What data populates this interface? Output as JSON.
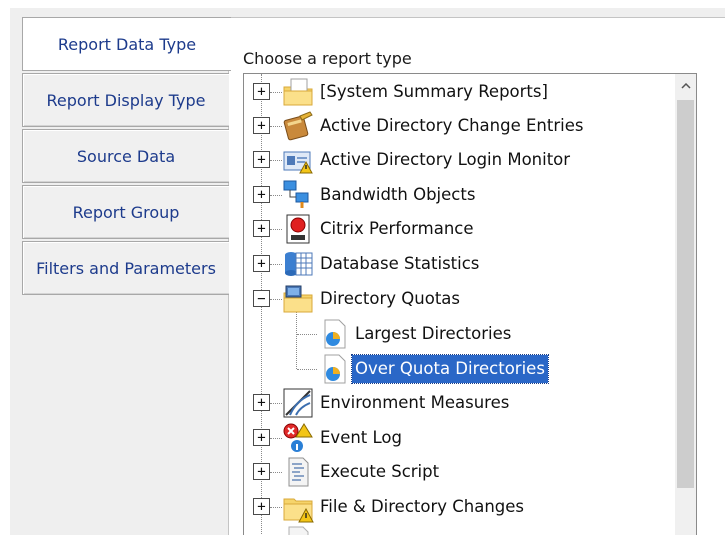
{
  "tabs": [
    {
      "label": "Report Data Type",
      "active": true
    },
    {
      "label": "Report Display Type",
      "active": false
    },
    {
      "label": "Source Data",
      "active": false
    },
    {
      "label": "Report Group",
      "active": false
    },
    {
      "label": "Filters and Parameters",
      "active": false
    }
  ],
  "panel": {
    "heading": "Choose a report type"
  },
  "tree": {
    "expander_collapsed": "+",
    "expander_expanded": "−",
    "items": [
      {
        "label": "[System Summary Reports]",
        "icon": "folder-document-icon",
        "state": "collapsed"
      },
      {
        "label": "Active Directory Change Entries",
        "icon": "book-pencil-icon",
        "state": "collapsed"
      },
      {
        "label": "Active Directory Login Monitor",
        "icon": "id-card-warning-icon",
        "state": "collapsed"
      },
      {
        "label": "Bandwidth Objects",
        "icon": "network-computers-icon",
        "state": "collapsed"
      },
      {
        "label": "Citrix Performance",
        "icon": "red-ball-icon",
        "state": "collapsed"
      },
      {
        "label": "Database Statistics",
        "icon": "database-grid-icon",
        "state": "collapsed"
      },
      {
        "label": "Directory Quotas",
        "icon": "folder-monitor-icon",
        "state": "expanded"
      },
      {
        "label": "Largest Directories",
        "icon": "pie-report-icon",
        "state": "child"
      },
      {
        "label": "Over Quota Directories",
        "icon": "pie-report-icon",
        "state": "child",
        "selected": true
      },
      {
        "label": "Environment Measures",
        "icon": "signal-waves-icon",
        "state": "collapsed"
      },
      {
        "label": "Event Log",
        "icon": "event-log-icon",
        "state": "collapsed"
      },
      {
        "label": "Execute Script",
        "icon": "script-icon",
        "state": "collapsed"
      },
      {
        "label": "File & Directory Changes",
        "icon": "folder-warning-icon",
        "state": "collapsed"
      }
    ]
  },
  "colors": {
    "tab_text": "#1d3b8c",
    "selection": "#2a67c7"
  }
}
